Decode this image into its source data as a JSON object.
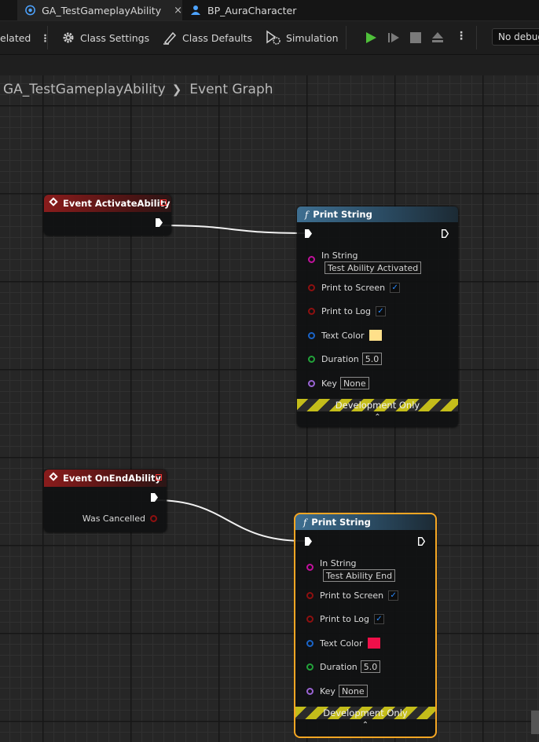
{
  "tabs": [
    {
      "label": "GA_TestGameplayAbility",
      "close": "×",
      "icon": "blueprint-icon",
      "active": true
    },
    {
      "label": "BP_AuraCharacter",
      "icon": "character-blueprint-icon",
      "active": false
    }
  ],
  "toolbar": {
    "related_label": "elated",
    "class_settings_label": "Class Settings",
    "class_defaults_label": "Class Defaults",
    "simulation_label": "Simulation",
    "debug_select": "No debug"
  },
  "breadcrumb": {
    "root": "GA_TestGameplayAbility",
    "current": "Event Graph"
  },
  "nodes": {
    "event_activate": {
      "title": "Event ActivateAbility"
    },
    "event_end": {
      "title": "Event OnEndAbility",
      "was_cancelled": "Was Cancelled"
    },
    "print1": {
      "title": "Print String",
      "in_string_label": "In String",
      "in_string_value": "Test Ability Activated",
      "print_screen_label": "Print to Screen",
      "print_log_label": "Print to Log",
      "text_color_label": "Text Color",
      "text_color": "#FFE08A",
      "duration_label": "Duration",
      "duration_value": "5.0",
      "key_label": "Key",
      "key_value": "None",
      "dev_only": "Development Only"
    },
    "print2": {
      "title": "Print String",
      "in_string_label": "In String",
      "in_string_value": "Test Ability End",
      "print_screen_label": "Print to Screen",
      "print_log_label": "Print to Log",
      "text_color_label": "Text Color",
      "text_color": "#F0104A",
      "duration_label": "Duration",
      "duration_value": "5.0",
      "key_label": "Key",
      "key_value": "None",
      "dev_only": "Development Only"
    }
  },
  "colors": {
    "selection_outline": "#F5A623",
    "checkbox_check": "#2A8BFF",
    "event_header": "#8A1C1C",
    "function_header": "#3E6F91"
  }
}
